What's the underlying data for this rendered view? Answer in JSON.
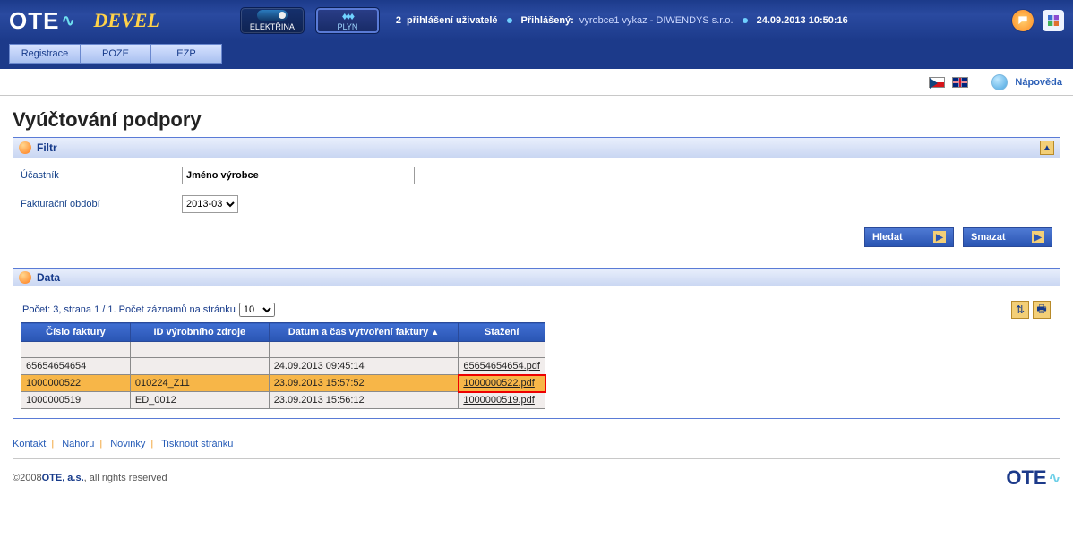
{
  "header": {
    "logo_text": "OTE",
    "env": "DEVEL",
    "tab_elec": "ELEKTŘINA",
    "tab_gas": "PLYN",
    "logged_count": "2",
    "logged_label": "přihlášení uživatelé",
    "user_label": "Přihlášený:",
    "user_name": "vyrobce1 vykaz - DIWENDYS s.r.o.",
    "timestamp": "24.09.2013 10:50:16"
  },
  "nav": {
    "items": [
      "Registrace",
      "POZE",
      "EZP"
    ]
  },
  "strip": {
    "help": "Nápověda"
  },
  "page": {
    "title": "Vyúčtování podpory",
    "filter": {
      "heading": "Filtr",
      "participant_label": "Účastník",
      "participant_value": "Jméno výrobce",
      "period_label": "Fakturační období",
      "period_value": "2013-03",
      "search_btn": "Hledat",
      "clear_btn": "Smazat"
    },
    "data": {
      "heading": "Data",
      "meta_prefix": "Počet: 3, strana 1 / 1. Počet záznamů na stránku",
      "page_size": "10",
      "columns": {
        "c1": "Číslo faktury",
        "c2": "ID výrobního zdroje",
        "c3": "Datum a čas vytvoření faktury",
        "c4": "Stažení"
      },
      "rows": [
        {
          "invoice": "65654654654",
          "source": "",
          "created": "24.09.2013 09:45:14",
          "download": "65654654654.pdf",
          "selected": false,
          "highlight": false
        },
        {
          "invoice": "1000000522",
          "source": "010224_Z11",
          "created": "23.09.2013 15:57:52",
          "download": "1000000522.pdf",
          "selected": true,
          "highlight": true
        },
        {
          "invoice": "1000000519",
          "source": "ED_0012",
          "created": "23.09.2013 15:56:12",
          "download": "1000000519.pdf",
          "selected": false,
          "highlight": false
        }
      ]
    }
  },
  "footer": {
    "links": [
      "Kontakt",
      "Nahoru",
      "Novinky",
      "Tisknout stránku"
    ],
    "copy_year": "©2008 ",
    "copy_company": "OTE, a.s.",
    "copy_rest": ", all rights reserved",
    "logo": "OTE"
  }
}
